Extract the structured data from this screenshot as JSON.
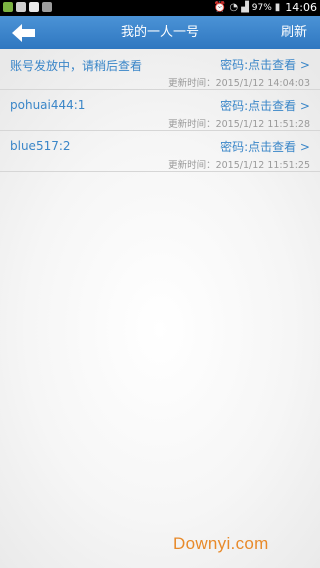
{
  "status_bar": {
    "battery": "97%",
    "time": "14:06"
  },
  "header": {
    "title": "我的一人一号",
    "refresh_label": "刷新"
  },
  "rows": [
    {
      "account": "账号发放中，请稍后查看",
      "password": "密码:点击查看 >",
      "updated": "更新时间：2015/1/12 14:04:03"
    },
    {
      "account": "pohuai444:1",
      "password": "密码:点击查看 >",
      "updated": "更新时间：2015/1/12 11:51:28"
    },
    {
      "account": "blue517:2",
      "password": "密码:点击查看 >",
      "updated": "更新时间：2015/1/12 11:51:25"
    }
  ],
  "watermark": "Downyi.com",
  "colors": {
    "header_bg": "#3b82c8",
    "link_blue": "#3a86c8",
    "muted": "#9a9a9a",
    "watermark": "#e88a2a"
  },
  "icons": {
    "back": "back-arrow-icon"
  }
}
